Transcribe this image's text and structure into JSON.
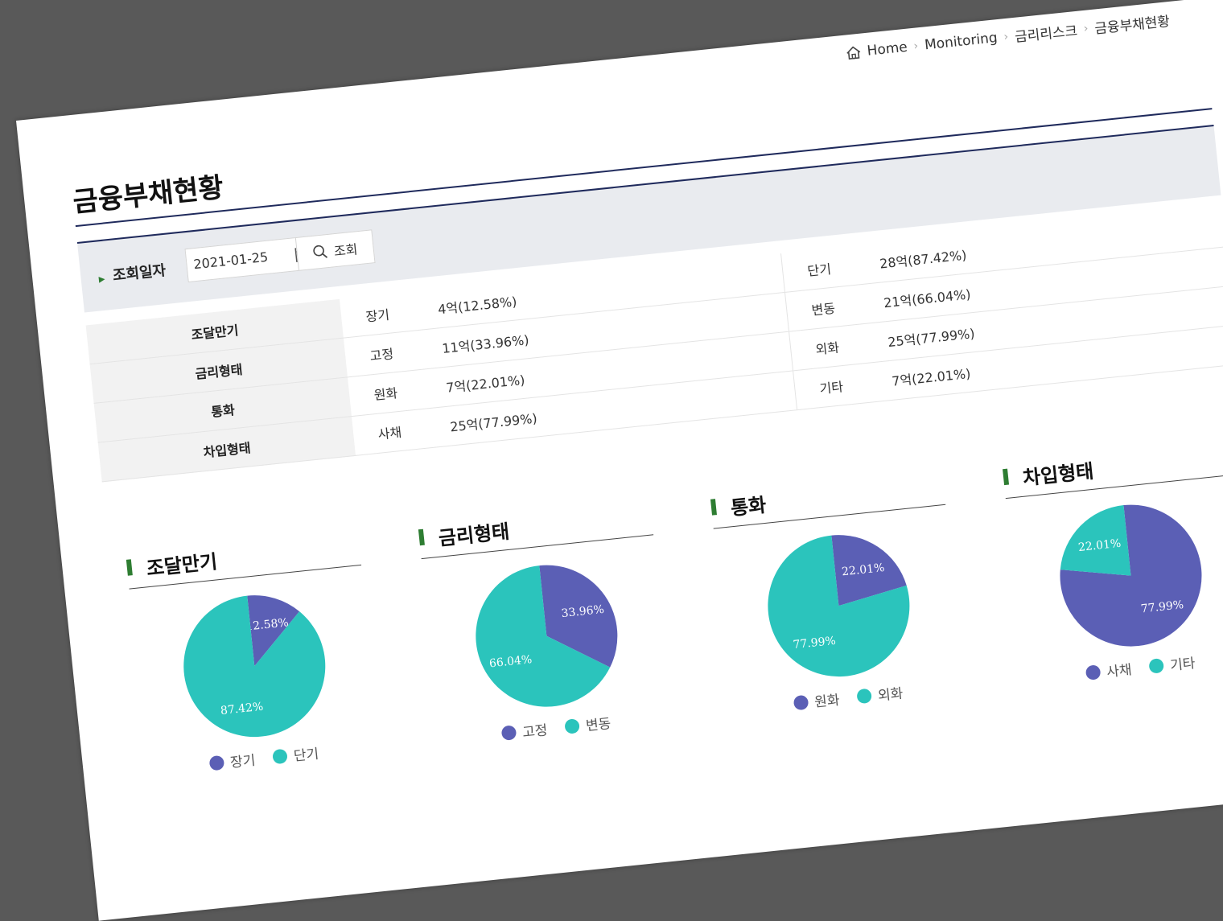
{
  "colors": {
    "purple": "#5b5fb5",
    "teal": "#2bc4bc",
    "navy": "#1f2a5c",
    "accent_green": "#2e7d32"
  },
  "breadcrumb": {
    "home": "Home",
    "items": [
      "Monitoring",
      "금리리스크",
      "금융부채현황"
    ]
  },
  "page_title": "금융부채현황",
  "search": {
    "label": "조회일자",
    "date": "2021-01-25",
    "button": "조회"
  },
  "summary": [
    {
      "label": "조달만기",
      "k1": "장기",
      "v1": "4억(12.58%)",
      "k2": "단기",
      "v2": "28억(87.42%)"
    },
    {
      "label": "금리형태",
      "k1": "고정",
      "v1": "11억(33.96%)",
      "k2": "변동",
      "v2": "21억(66.04%)"
    },
    {
      "label": "통화",
      "k1": "원화",
      "v1": "7억(22.01%)",
      "k2": "외화",
      "v2": "25억(77.99%)"
    },
    {
      "label": "차입형태",
      "k1": "사채",
      "v1": "25억(77.99%)",
      "k2": "기타",
      "v2": "7억(22.01%)"
    }
  ],
  "chart_data": [
    {
      "type": "pie",
      "title": "조달만기",
      "labels": [
        "장기",
        "단기"
      ],
      "values": [
        12.58,
        87.42
      ],
      "slice_labels": [
        "12.58%",
        "87.42%"
      ],
      "colors": [
        "#5b5fb5",
        "#2bc4bc"
      ]
    },
    {
      "type": "pie",
      "title": "금리형태",
      "labels": [
        "고정",
        "변동"
      ],
      "values": [
        33.96,
        66.04
      ],
      "slice_labels": [
        "33.96%",
        "66.04%"
      ],
      "colors": [
        "#5b5fb5",
        "#2bc4bc"
      ]
    },
    {
      "type": "pie",
      "title": "통화",
      "labels": [
        "원화",
        "외화"
      ],
      "values": [
        22.01,
        77.99
      ],
      "slice_labels": [
        "22.01%",
        "77.99%"
      ],
      "colors": [
        "#5b5fb5",
        "#2bc4bc"
      ]
    },
    {
      "type": "pie",
      "title": "차입형태",
      "labels": [
        "사채",
        "기타"
      ],
      "values": [
        77.99,
        22.01
      ],
      "slice_labels": [
        "77.99%",
        "22.01%"
      ],
      "colors": [
        "#5b5fb5",
        "#2bc4bc"
      ]
    }
  ]
}
